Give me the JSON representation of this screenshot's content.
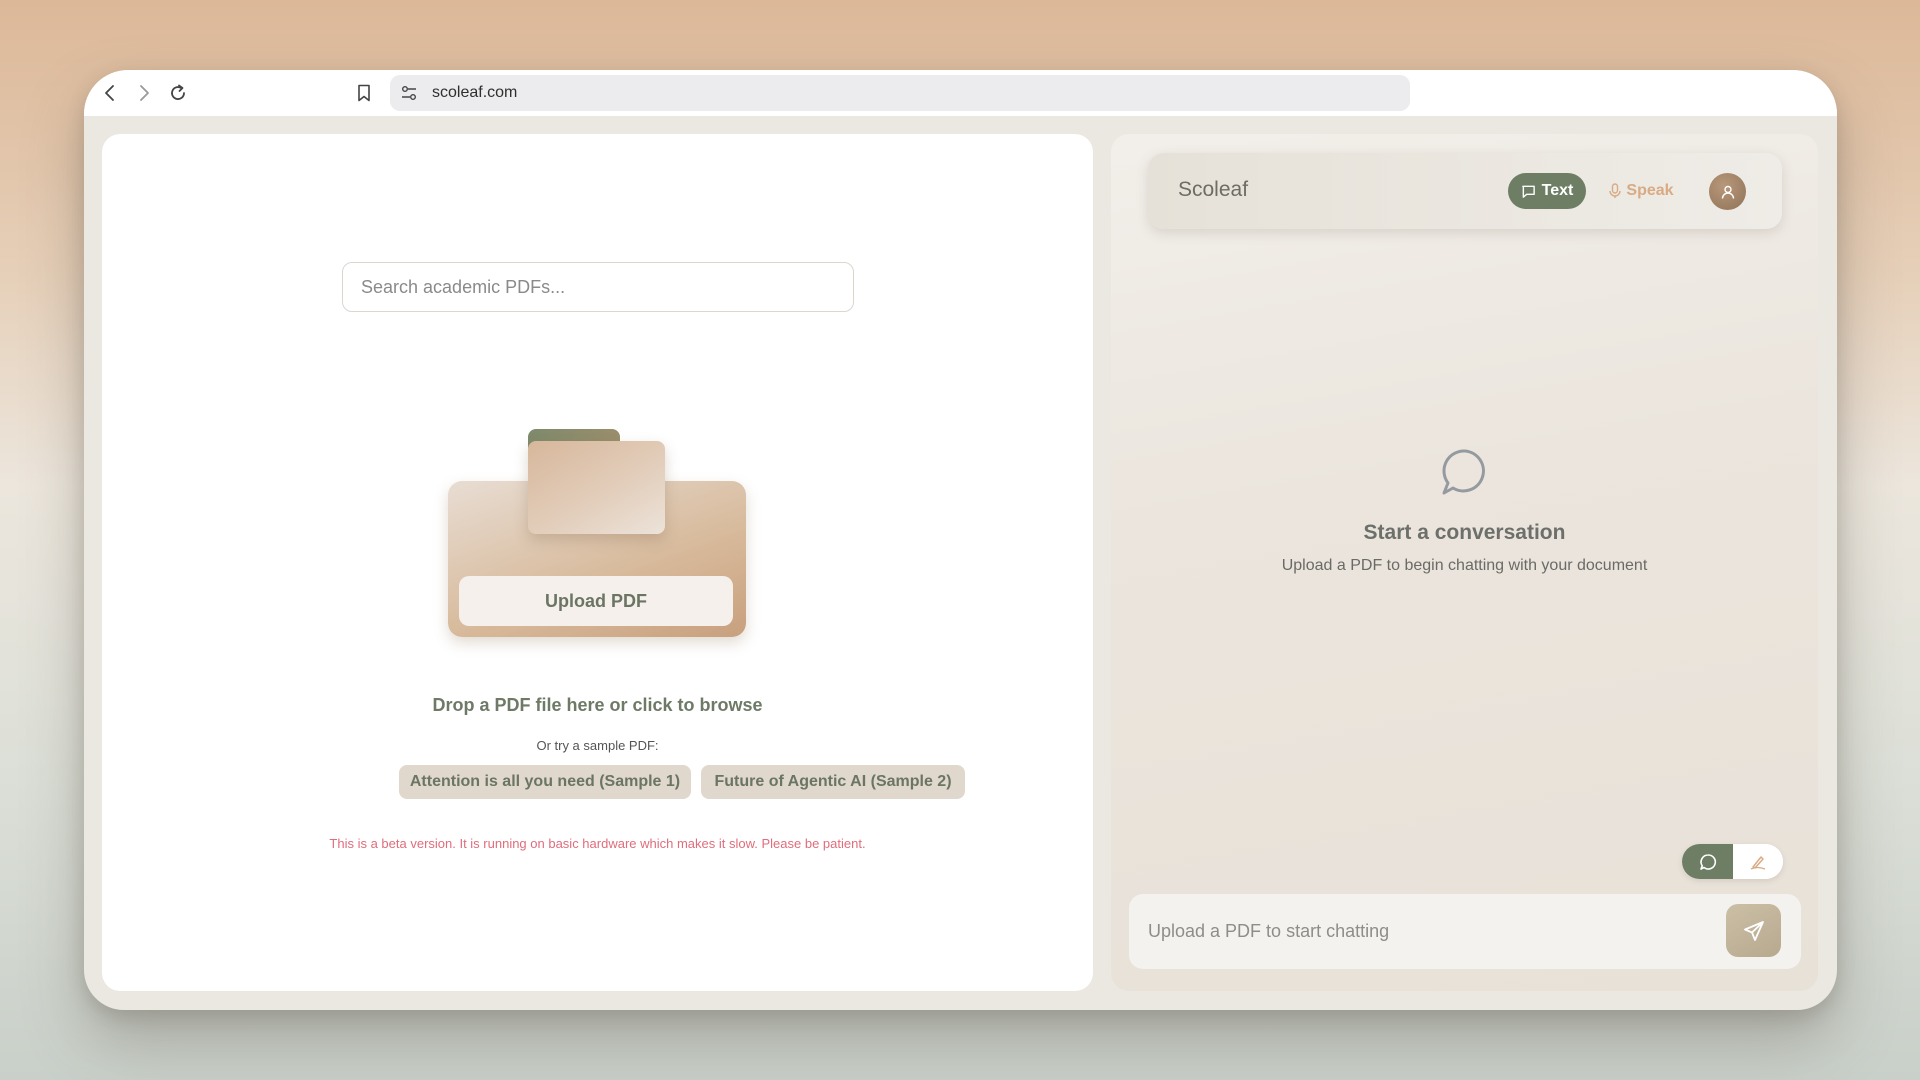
{
  "browser": {
    "url": "scoleaf.com",
    "back_icon": "chevron-left-icon",
    "forward_icon": "chevron-right-icon",
    "reload_icon": "reload-icon",
    "bookmark_icon": "bookmark-icon",
    "site_settings_icon": "tune-icon"
  },
  "left": {
    "search_placeholder": "Search academic PDFs...",
    "upload_label": "Upload PDF",
    "drop_text": "Drop a PDF file here or click to browse",
    "sample_label": "Or try a sample PDF:",
    "samples": [
      "Attention is all you need (Sample 1)",
      "Future of Agentic AI (Sample 2)"
    ],
    "beta_notice": "This is a beta version. It is running on basic hardware which makes it slow. Please be patient."
  },
  "right": {
    "brand": "Scoleaf",
    "modes": {
      "text": "Text",
      "speak": "Speak",
      "active": "text"
    },
    "empty_title": "Start a conversation",
    "empty_subtitle": "Upload a PDF to begin chatting with your document",
    "input_placeholder": "Upload a PDF to start chatting"
  },
  "colors": {
    "accent_green": "#6d7e65",
    "speak_tan": "#d8ab84",
    "beta_red": "#e06d7c"
  }
}
